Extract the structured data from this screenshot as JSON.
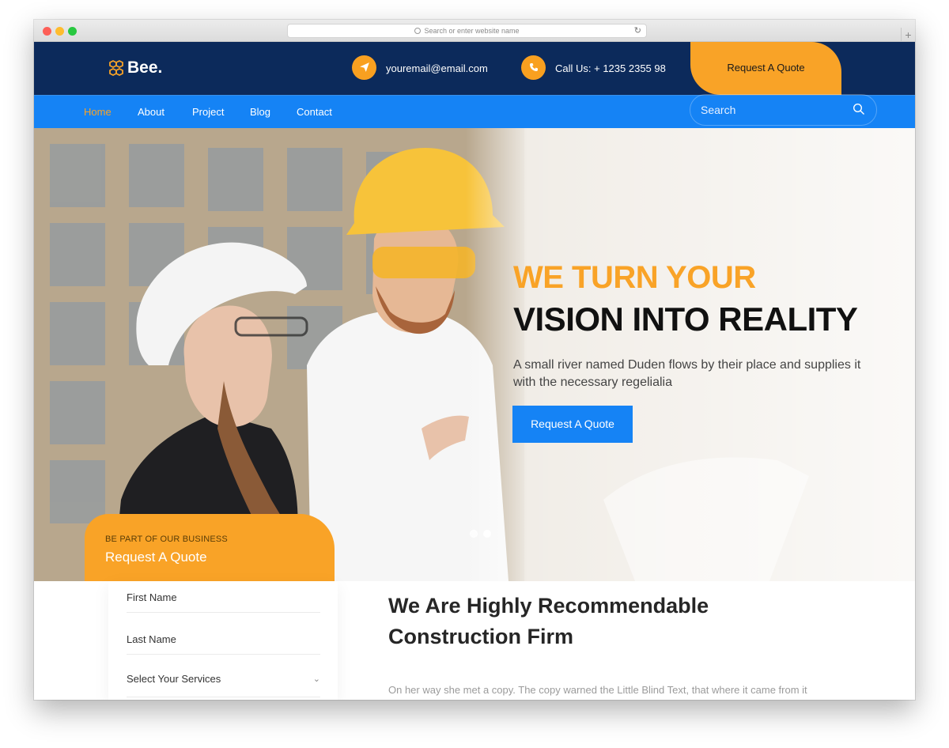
{
  "browser": {
    "address_placeholder": "Search or enter website name",
    "reload_icon": "reload-icon",
    "new_tab_icon": "plus-icon"
  },
  "header": {
    "logo_text": "Bee.",
    "logo_icon": "honeycomb-icon",
    "email": "youremail@email.com",
    "email_icon": "paper-plane-icon",
    "phone": "Call Us: + 1235 2355 98",
    "phone_icon": "phone-icon",
    "quote_button": "Request A Quote"
  },
  "nav": {
    "items": [
      {
        "label": "Home",
        "active": true
      },
      {
        "label": "About",
        "active": false
      },
      {
        "label": "Project",
        "active": false
      },
      {
        "label": "Blog",
        "active": false
      },
      {
        "label": "Contact",
        "active": false
      }
    ],
    "search_placeholder": "Search"
  },
  "hero": {
    "tagline_line1": "WE TURN YOUR",
    "tagline_line2": "VISION INTO REALITY",
    "description": "A small river named Duden flows by their place and supplies it with the necessary regelialia",
    "button": "Request A Quote",
    "slide_count": 2,
    "active_slide": 2
  },
  "quote_card": {
    "kicker": "BE PART OF OUR BUSINESS",
    "title": "Request A Quote"
  },
  "form": {
    "first_name_placeholder": "First Name",
    "last_name_placeholder": "Last Name",
    "services_select": "Select Your Services"
  },
  "about": {
    "title": "We Are Highly Recommendable Construction Firm",
    "text": "On her way she met a copy. The copy warned the Little Blind Text, that where it came from it"
  },
  "colors": {
    "navy": "#0c2a5b",
    "blue": "#1583f5",
    "orange": "#f9a327"
  }
}
